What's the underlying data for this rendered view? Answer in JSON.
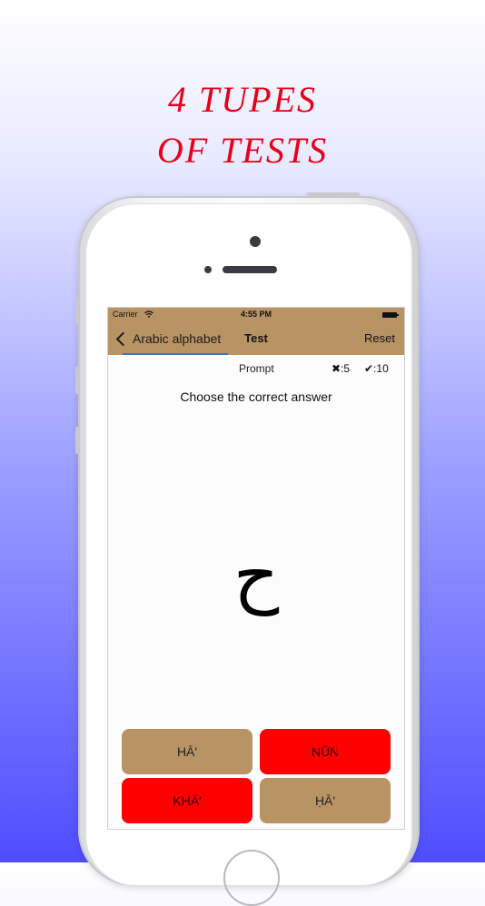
{
  "promo": {
    "line1": "4 TUPES",
    "line2": "OF TESTS"
  },
  "status_bar": {
    "carrier": "Carrier",
    "time": "4:55 PM"
  },
  "nav": {
    "back_label": "Arabic alphabet",
    "title": "Test",
    "reset_label": "Reset"
  },
  "quiz": {
    "prompt_label": "Prompt",
    "wrong_count": "✖:5",
    "correct_count": "✔:10",
    "instruction": "Choose the correct answer",
    "letter": "ح",
    "answers": [
      {
        "label": "HĀ'"
      },
      {
        "label": "NŪN"
      },
      {
        "label": "KHĀ'"
      },
      {
        "label": "ḤĀ'"
      }
    ]
  },
  "colors": {
    "headline": "#e8001a",
    "navbar": "#b89465",
    "answer_tan": "#b89465",
    "answer_red": "#ff0000",
    "progress": "#3478c8"
  }
}
